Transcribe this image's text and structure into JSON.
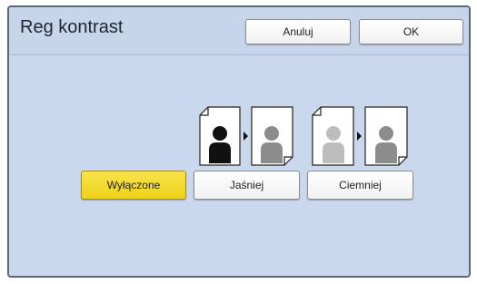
{
  "header": {
    "title": "Reg kontrast",
    "cancel_label": "Anuluj",
    "ok_label": "OK"
  },
  "options": {
    "off_label": "Wyłączone",
    "lighter_label": "Jaśniej",
    "darker_label": "Ciemniej",
    "selected": "off"
  },
  "colors": {
    "panel_bg": "#c9d8ec",
    "selected_button": "#f5dc2c",
    "figure_black": "#111111",
    "figure_gray": "#8c8c8c",
    "figure_light": "#bdbdbd"
  },
  "icons": {
    "lighter_illustration": "dark-to-gray-figure-icon",
    "darker_illustration": "light-to-gray-figure-icon"
  }
}
